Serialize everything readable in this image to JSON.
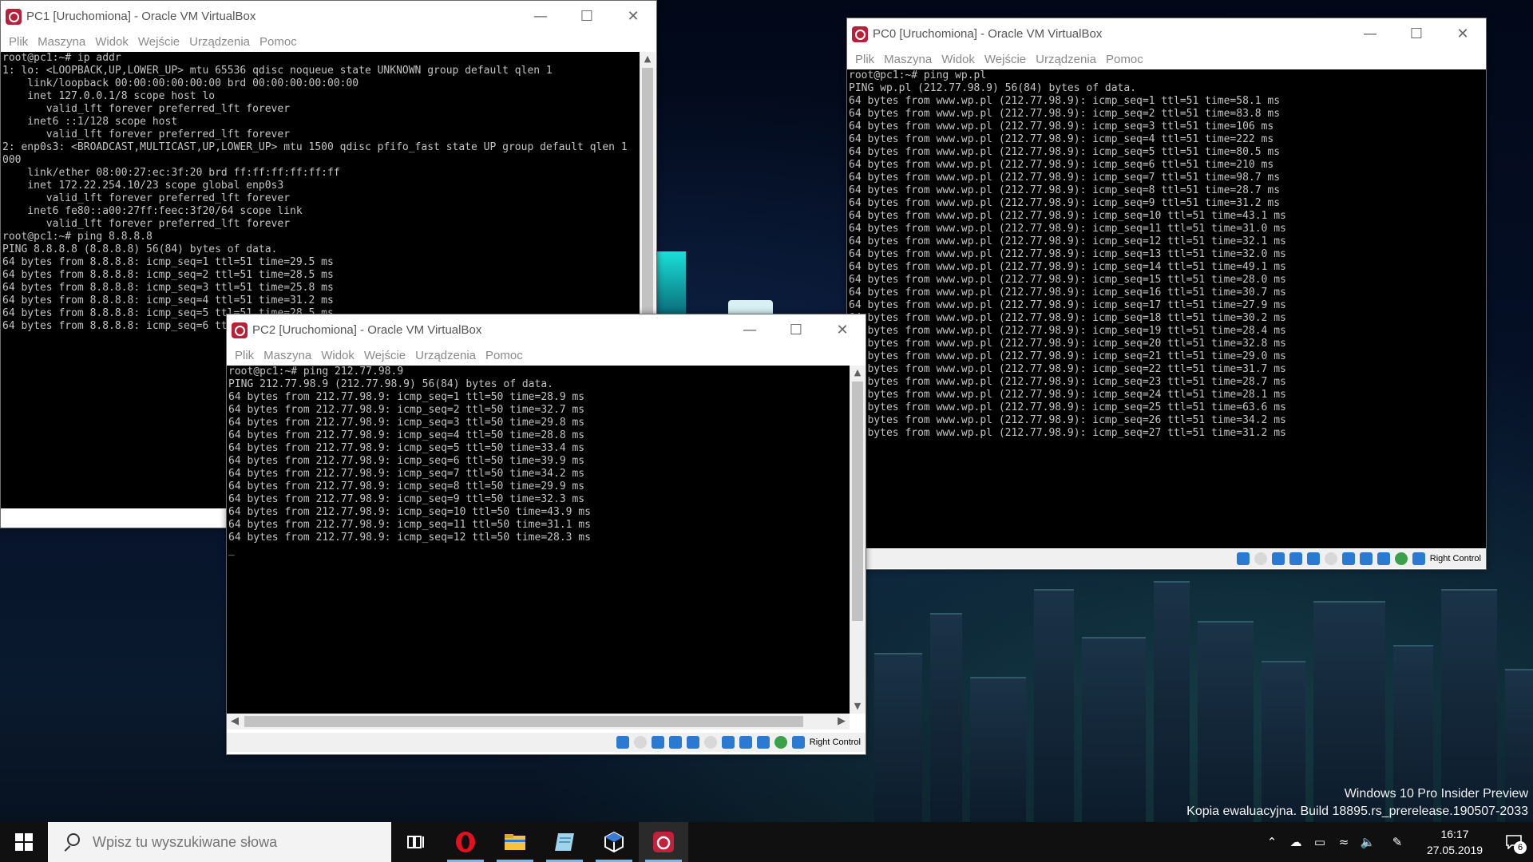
{
  "desktop": {
    "watermark": {
      "line1": "Windows 10 Pro Insider Preview",
      "line2": "Kopia ewaluacyjna. Build 18895.rs_prerelease.190507-2033"
    }
  },
  "menu_items": [
    "Plik",
    "Maszyna",
    "Widok",
    "Wejście",
    "Urządzenia",
    "Pomoc"
  ],
  "windows": {
    "pc1": {
      "title": "PC1 [Uruchomiona] - Oracle VM VirtualBox",
      "console": "root@pc1:~# ip addr\n1: lo: <LOOPBACK,UP,LOWER_UP> mtu 65536 qdisc noqueue state UNKNOWN group default qlen 1\n    link/loopback 00:00:00:00:00:00 brd 00:00:00:00:00:00\n    inet 127.0.0.1/8 scope host lo\n       valid_lft forever preferred_lft forever\n    inet6 ::1/128 scope host\n       valid_lft forever preferred_lft forever\n2: enp0s3: <BROADCAST,MULTICAST,UP,LOWER_UP> mtu 1500 qdisc pfifo_fast state UP group default qlen 1\n000\n    link/ether 08:00:27:ec:3f:20 brd ff:ff:ff:ff:ff:ff\n    inet 172.22.254.10/23 scope global enp0s3\n       valid_lft forever preferred_lft forever\n    inet6 fe80::a00:27ff:feec:3f20/64 scope link\n       valid_lft forever preferred_lft forever\nroot@pc1:~# ping 8.8.8.8\nPING 8.8.8.8 (8.8.8.8) 56(84) bytes of data.\n64 bytes from 8.8.8.8: icmp_seq=1 ttl=51 time=29.5 ms\n64 bytes from 8.8.8.8: icmp_seq=2 ttl=51 time=28.5 ms\n64 bytes from 8.8.8.8: icmp_seq=3 ttl=51 time=25.8 ms\n64 bytes from 8.8.8.8: icmp_seq=4 ttl=51 time=31.2 ms\n64 bytes from 8.8.8.8: icmp_seq=5 ttl=51 time=28.5 ms\n64 bytes from 8.8.8.8: icmp_seq=6 ttl=51 time=28.4 ms"
    },
    "pc0": {
      "title": "PC0 [Uruchomiona] - Oracle VM VirtualBox",
      "console": "root@pc1:~# ping wp.pl\nPING wp.pl (212.77.98.9) 56(84) bytes of data.\n64 bytes from www.wp.pl (212.77.98.9): icmp_seq=1 ttl=51 time=58.1 ms\n64 bytes from www.wp.pl (212.77.98.9): icmp_seq=2 ttl=51 time=83.8 ms\n64 bytes from www.wp.pl (212.77.98.9): icmp_seq=3 ttl=51 time=106 ms\n64 bytes from www.wp.pl (212.77.98.9): icmp_seq=4 ttl=51 time=222 ms\n64 bytes from www.wp.pl (212.77.98.9): icmp_seq=5 ttl=51 time=80.5 ms\n64 bytes from www.wp.pl (212.77.98.9): icmp_seq=6 ttl=51 time=210 ms\n64 bytes from www.wp.pl (212.77.98.9): icmp_seq=7 ttl=51 time=98.7 ms\n64 bytes from www.wp.pl (212.77.98.9): icmp_seq=8 ttl=51 time=28.7 ms\n64 bytes from www.wp.pl (212.77.98.9): icmp_seq=9 ttl=51 time=31.2 ms\n64 bytes from www.wp.pl (212.77.98.9): icmp_seq=10 ttl=51 time=43.1 ms\n64 bytes from www.wp.pl (212.77.98.9): icmp_seq=11 ttl=51 time=31.0 ms\n64 bytes from www.wp.pl (212.77.98.9): icmp_seq=12 ttl=51 time=32.1 ms\n64 bytes from www.wp.pl (212.77.98.9): icmp_seq=13 ttl=51 time=32.0 ms\n64 bytes from www.wp.pl (212.77.98.9): icmp_seq=14 ttl=51 time=49.1 ms\n64 bytes from www.wp.pl (212.77.98.9): icmp_seq=15 ttl=51 time=28.0 ms\n64 bytes from www.wp.pl (212.77.98.9): icmp_seq=16 ttl=51 time=30.7 ms\n64 bytes from www.wp.pl (212.77.98.9): icmp_seq=17 ttl=51 time=27.9 ms\n64 bytes from www.wp.pl (212.77.98.9): icmp_seq=18 ttl=51 time=30.2 ms\n64 bytes from www.wp.pl (212.77.98.9): icmp_seq=19 ttl=51 time=28.4 ms\n64 bytes from www.wp.pl (212.77.98.9): icmp_seq=20 ttl=51 time=32.8 ms\n64 bytes from www.wp.pl (212.77.98.9): icmp_seq=21 ttl=51 time=29.0 ms\n64 bytes from www.wp.pl (212.77.98.9): icmp_seq=22 ttl=51 time=31.7 ms\n64 bytes from www.wp.pl (212.77.98.9): icmp_seq=23 ttl=51 time=28.7 ms\n64 bytes from www.wp.pl (212.77.98.9): icmp_seq=24 ttl=51 time=28.1 ms\n64 bytes from www.wp.pl (212.77.98.9): icmp_seq=25 ttl=51 time=63.6 ms\n64 bytes from www.wp.pl (212.77.98.9): icmp_seq=26 ttl=51 time=34.2 ms\n64 bytes from www.wp.pl (212.77.98.9): icmp_seq=27 ttl=51 time=31.2 ms",
      "host_key": "Right Control"
    },
    "pc2": {
      "title": "PC2 [Uruchomiona] - Oracle VM VirtualBox",
      "console": "root@pc1:~# ping 212.77.98.9\nPING 212.77.98.9 (212.77.98.9) 56(84) bytes of data.\n64 bytes from 212.77.98.9: icmp_seq=1 ttl=50 time=28.9 ms\n64 bytes from 212.77.98.9: icmp_seq=2 ttl=50 time=32.7 ms\n64 bytes from 212.77.98.9: icmp_seq=3 ttl=50 time=29.8 ms\n64 bytes from 212.77.98.9: icmp_seq=4 ttl=50 time=28.8 ms\n64 bytes from 212.77.98.9: icmp_seq=5 ttl=50 time=33.4 ms\n64 bytes from 212.77.98.9: icmp_seq=6 ttl=50 time=39.9 ms\n64 bytes from 212.77.98.9: icmp_seq=7 ttl=50 time=34.2 ms\n64 bytes from 212.77.98.9: icmp_seq=8 ttl=50 time=29.9 ms\n64 bytes from 212.77.98.9: icmp_seq=9 ttl=50 time=32.3 ms\n64 bytes from 212.77.98.9: icmp_seq=10 ttl=50 time=43.9 ms\n64 bytes from 212.77.98.9: icmp_seq=11 ttl=50 time=31.1 ms\n64 bytes from 212.77.98.9: icmp_seq=12 ttl=50 time=28.3 ms\n_",
      "host_key": "Right Control"
    }
  },
  "taskbar": {
    "search_placeholder": "Wpisz tu wyszukiwane słowa",
    "apps": [
      "task-view-icon",
      "opera-icon",
      "file-explorer-icon",
      "notepad-icon",
      "virtualbox-icon",
      "virtualbox-vm-icon"
    ],
    "clock_time": "16:17",
    "clock_date": "27.05.2019",
    "notification_count": "6",
    "accent": "#76b9ed"
  }
}
